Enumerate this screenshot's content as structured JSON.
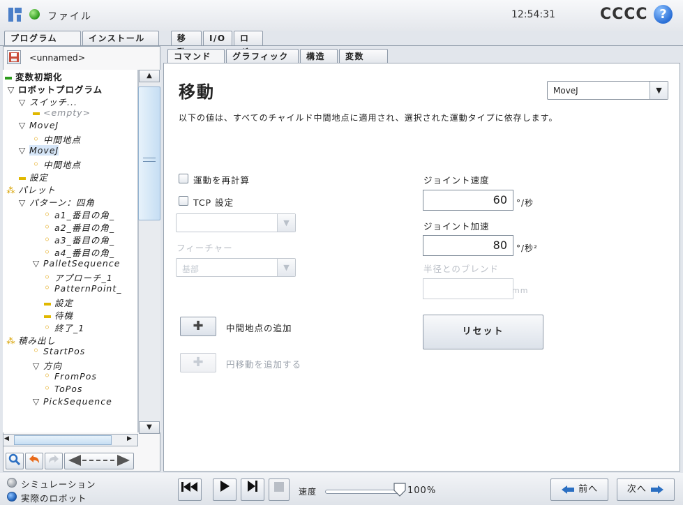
{
  "app": {
    "file_title": "ファイル",
    "clock": "12:54:31",
    "robot_name": "CCCC",
    "help_symbol": "?",
    "logo": "UR"
  },
  "main_tabs": [
    "プログラム",
    "インストール",
    "移動",
    "I/O",
    "ログ"
  ],
  "left": {
    "program_name": "<unnamed>"
  },
  "tree": [
    {
      "label": "変数初期化",
      "icon": "dash-icon"
    },
    {
      "label": "ロボットプログラム",
      "icon": "triangle-down-icon"
    },
    {
      "label": "スイッチ...",
      "icon": "triangle-down-icon"
    },
    {
      "label": "<empty>",
      "icon": "dash-icon"
    },
    {
      "label": "MoveJ",
      "icon": "triangle-down-icon"
    },
    {
      "label": "中間地点",
      "icon": "waypoint-icon"
    },
    {
      "label": "MoveJ",
      "icon": "triangle-down-icon"
    },
    {
      "label": "中間地点",
      "icon": "waypoint-icon"
    },
    {
      "label": "設定",
      "icon": "dash-icon"
    },
    {
      "label": "パレット",
      "icon": "pallet-icon"
    },
    {
      "label": "パターン：四角",
      "icon": "triangle-down-icon"
    },
    {
      "label": "a1_番目の角_",
      "icon": "waypoint-icon"
    },
    {
      "label": "a2_番目の角_",
      "icon": "waypoint-icon"
    },
    {
      "label": "a3_番目の角_",
      "icon": "waypoint-icon"
    },
    {
      "label": "a4_番目の角_",
      "icon": "waypoint-icon"
    },
    {
      "label": "PalletSequence",
      "icon": "triangle-down-icon"
    },
    {
      "label": "アプローチ_1",
      "icon": "waypoint-icon"
    },
    {
      "label": "PatternPoint_",
      "icon": "waypoint-icon"
    },
    {
      "label": "設定",
      "icon": "dash-icon"
    },
    {
      "label": "待機",
      "icon": "dash-icon"
    },
    {
      "label": "終了_1",
      "icon": "waypoint-icon"
    },
    {
      "label": "積み出し",
      "icon": "pallet-icon"
    },
    {
      "label": "StartPos",
      "icon": "waypoint-icon"
    },
    {
      "label": "方向",
      "icon": "triangle-down-icon"
    },
    {
      "label": "FromPos",
      "icon": "waypoint-icon"
    },
    {
      "label": "ToPos",
      "icon": "waypoint-icon"
    },
    {
      "label": "PickSequence",
      "icon": "triangle-down-icon"
    }
  ],
  "content_tabs": [
    "コマンド",
    "グラフィック",
    "構造",
    "変数"
  ],
  "command": {
    "title": "移動",
    "move_type": "MoveJ",
    "description": "以下の値は、すべてのチャイルド中間地点に適用され、選択された運動タイプに依存します。",
    "recalc_label": "運動を再計算",
    "tcp_label": "TCP 設定",
    "feature_label": "フィーチャー",
    "feature_value": "基部",
    "add_waypoint": "中間地点の追加",
    "add_circle": "円移動を追加する",
    "joint_speed_label": "ジョイント速度",
    "joint_speed_value": "60",
    "joint_speed_unit": "°/秒",
    "joint_accel_label": "ジョイント加速",
    "joint_accel_value": "80",
    "joint_accel_unit": "°/秒²",
    "blend_label": "半径とのブレンド",
    "blend_unit": "mm",
    "reset": "リセット"
  },
  "footer": {
    "simulation": "シミュレーション",
    "real_robot": "実際のロボット",
    "speed_label": "速度",
    "speed_value": "100%",
    "speed_fraction": 1.0,
    "prev": "前へ",
    "next": "次へ"
  },
  "colors": {
    "accent": "#2a6fd6",
    "status_green": "#2c9a1c",
    "nav_blue": "#2b6fc2",
    "undo_orange": "#e86a1a"
  }
}
